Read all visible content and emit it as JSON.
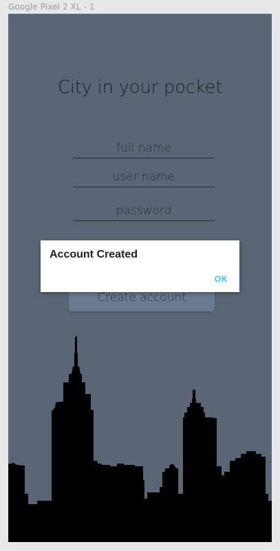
{
  "canvas": {
    "label": "Google Pixel 2 XL - 1"
  },
  "app": {
    "title": "City in your pocket"
  },
  "form": {
    "fullname_placeholder": "full name",
    "username_placeholder": "user name",
    "password_placeholder": "password",
    "submit_label": "Create account"
  },
  "dialog": {
    "title": "Account Created",
    "ok_label": "OK"
  },
  "colors": {
    "background": "#5a6675",
    "accent": "#1dd6c4",
    "dialog_bg": "#ffffff"
  },
  "illustration": {
    "icon": "city-skyline-icon"
  }
}
